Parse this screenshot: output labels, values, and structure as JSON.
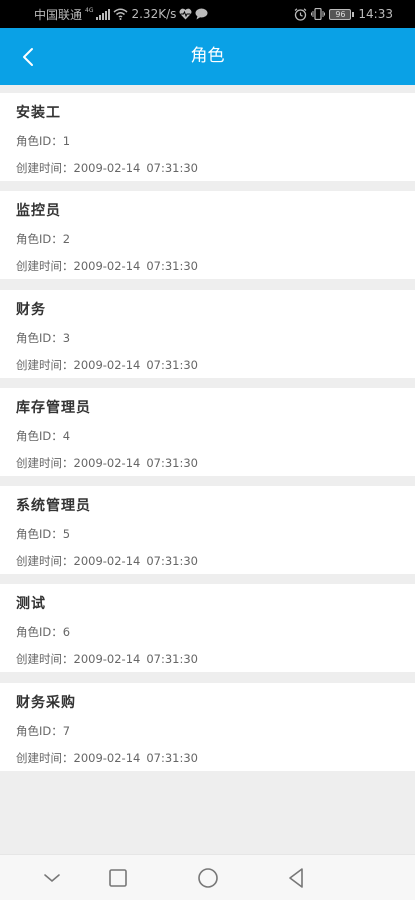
{
  "status_bar": {
    "carrier": "中国联通",
    "network_type": "4G",
    "speed": "2.32K/s",
    "battery": "96",
    "time": "14:33"
  },
  "header": {
    "title": "角色"
  },
  "labels": {
    "id_prefix": "角色ID：",
    "time_prefix": "创建时间："
  },
  "roles": [
    {
      "name": "安装工",
      "id": "1",
      "date": "2009-02-14",
      "clock": "07:31:30"
    },
    {
      "name": "监控员",
      "id": "2",
      "date": "2009-02-14",
      "clock": "07:31:30"
    },
    {
      "name": "财务",
      "id": "3",
      "date": "2009-02-14",
      "clock": "07:31:30"
    },
    {
      "name": "库存管理员",
      "id": "4",
      "date": "2009-02-14",
      "clock": "07:31:30"
    },
    {
      "name": "系统管理员",
      "id": "5",
      "date": "2009-02-14",
      "clock": "07:31:30"
    },
    {
      "name": "测试",
      "id": "6",
      "date": "2009-02-14",
      "clock": "07:31:30"
    },
    {
      "name": "财务采购",
      "id": "7",
      "date": "2009-02-14",
      "clock": "07:31:30"
    }
  ],
  "colors": {
    "header_bg": "#0aa1e6",
    "page_bg": "#eeeeee",
    "card_bg": "#ffffff"
  },
  "icons": {
    "back": "chevron-left-icon",
    "nav_down": "chevron-down-icon",
    "nav_recents": "square-icon",
    "nav_home": "circle-icon",
    "nav_back": "triangle-back-icon"
  }
}
